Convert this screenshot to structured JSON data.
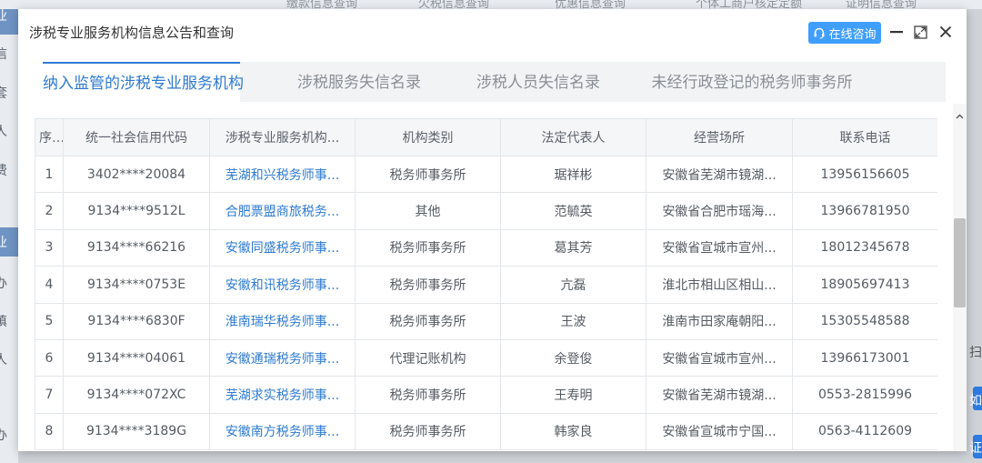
{
  "background": {
    "top_tabs": [
      "缴款信息查询",
      "欠税信息查询",
      "优惠信息查询",
      "个体工商户核定定额",
      "证明信息查询"
    ],
    "left_fragments": [
      "信",
      "套",
      "人",
      "费",
      "业",
      "办",
      "填",
      "人",
      "办"
    ],
    "right_fragments": [
      "扫",
      "如",
      "证"
    ]
  },
  "dialog": {
    "title": "涉税专业服务机构信息公告和查询",
    "consult_button": "在线咨询",
    "tabs": [
      {
        "label": "纳入监管的涉税专业服务机构",
        "active": true
      },
      {
        "label": "涉税服务失信名录",
        "active": false
      },
      {
        "label": "涉税人员失信名录",
        "active": false
      },
      {
        "label": "未经行政登记的税务师事务所",
        "active": false
      }
    ],
    "table": {
      "columns": [
        "序号",
        "统一社会信用代码",
        "涉税专业服务机构...",
        "机构类别",
        "法定代表人",
        "经营场所",
        "联系电话"
      ],
      "rows": [
        [
          "1",
          "3402****20084",
          "芜湖和兴税务师事...",
          "税务师事务所",
          "琚祥彬",
          "安徽省芜湖市镜湖...",
          "13956156605"
        ],
        [
          "2",
          "9134****9512L",
          "合肥票盟商旅税务...",
          "其他",
          "范毓英",
          "安徽省合肥市瑶海...",
          "13966781950"
        ],
        [
          "3",
          "9134****66216",
          "安徽同盛税务师事...",
          "税务师事务所",
          "葛其芳",
          "安徽省宣城市宣州...",
          "18012345678"
        ],
        [
          "4",
          "9134****0753E",
          "安徽和讯税务师事...",
          "税务师事务所",
          "亢磊",
          "淮北市相山区相山...",
          "18905697413"
        ],
        [
          "5",
          "9134****6830F",
          "淮南瑞华税务师事...",
          "税务师事务所",
          "王波",
          "淮南市田家庵朝阳...",
          "15305548588"
        ],
        [
          "6",
          "9134****04061",
          "安徽通瑞税务师事...",
          "代理记账机构",
          "余登俊",
          "安徽省宣城市宣州...",
          "13966173001"
        ],
        [
          "7",
          "9134****072XC",
          "芜湖求实税务师事...",
          "税务师事务所",
          "王寿明",
          "安徽省芜湖市镜湖...",
          "0553-2815996"
        ],
        [
          "8",
          "9134****3189G",
          "安徽南方税务师事...",
          "税务师事务所",
          "韩家良",
          "安徽省宣城市宁国...",
          "0563-4112609"
        ]
      ]
    }
  },
  "colors": {
    "accent": "#2e7ad1",
    "consult_button": "#409eff",
    "header_bg": "#f5f6f8",
    "tab_bar_bg": "#f2f3f5"
  },
  "icons": {
    "consult": "headset-icon",
    "minimize": "minimize-icon",
    "maximize": "maximize-icon",
    "close": "close-icon",
    "scroll_up": "chevron-up-icon"
  }
}
